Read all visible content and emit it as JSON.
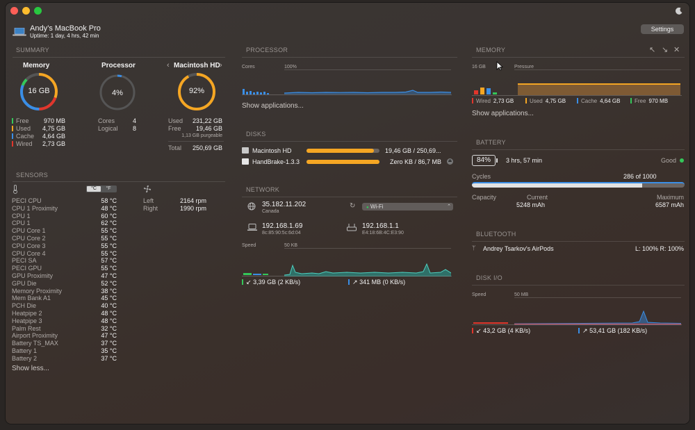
{
  "header": {
    "device_name": "Andy’s MacBook Pro",
    "uptime": "Uptime: 1 day, 4 hrs, 42 min",
    "settings_label": "Settings"
  },
  "summary": {
    "title": "SUMMARY",
    "memory": {
      "label": "Memory",
      "center": "16 GB",
      "rows": [
        {
          "name": "Free",
          "value": "970 MB",
          "color": "#34c759"
        },
        {
          "name": "Used",
          "value": "4,75 GB",
          "color": "#f5a623"
        },
        {
          "name": "Cache",
          "value": "4,64 GB",
          "color": "#3a8ee6"
        },
        {
          "name": "Wired",
          "value": "2,73 GB",
          "color": "#e0362c"
        }
      ]
    },
    "processor": {
      "label": "Processor",
      "center": "4%",
      "rows": [
        {
          "name": "Cores",
          "value": "4"
        },
        {
          "name": "Logical",
          "value": "8"
        }
      ]
    },
    "disk": {
      "label": "Macintosh HD",
      "center": "92%",
      "used_label": "Used",
      "used": "231,22 GB",
      "free_label": "Free",
      "free": "19,46 GB",
      "purgeable": "1,13 GB purgeable",
      "total_label": "Total",
      "total": "250,69 GB"
    }
  },
  "sensors": {
    "title": "SENSORS",
    "unit_c": "°C",
    "unit_f": "°F",
    "items": [
      {
        "name": "PECI CPU",
        "value": "58 °C"
      },
      {
        "name": "CPU 1 Proximity",
        "value": "48 °C"
      },
      {
        "name": "CPU 1",
        "value": "60 °C"
      },
      {
        "name": "CPU 1",
        "value": "62 °C"
      },
      {
        "name": "CPU Core 1",
        "value": "55 °C"
      },
      {
        "name": "CPU Core 2",
        "value": "55 °C"
      },
      {
        "name": "CPU Core 3",
        "value": "55 °C"
      },
      {
        "name": "CPU Core 4",
        "value": "55 °C"
      },
      {
        "name": "PECI SA",
        "value": "57 °C"
      },
      {
        "name": "PECI GPU",
        "value": "55 °C"
      },
      {
        "name": "GPU Proximity",
        "value": "47 °C"
      },
      {
        "name": "GPU Die",
        "value": "52 °C"
      },
      {
        "name": "Memory Proximity",
        "value": "38 °C"
      },
      {
        "name": "Mem Bank A1",
        "value": "45 °C"
      },
      {
        "name": "PCH Die",
        "value": "40 °C"
      },
      {
        "name": "Heatpipe 2",
        "value": "48 °C"
      },
      {
        "name": "Heatpipe 3",
        "value": "48 °C"
      },
      {
        "name": "Palm Rest",
        "value": "32 °C"
      },
      {
        "name": "Airport Proximity",
        "value": "47 °C"
      },
      {
        "name": "Battery TS_MAX",
        "value": "37 °C"
      },
      {
        "name": "Battery 1",
        "value": "35 °C"
      },
      {
        "name": "Battery 2",
        "value": "37 °C"
      }
    ],
    "fans": [
      {
        "name": "Left",
        "value": "2164 rpm"
      },
      {
        "name": "Right",
        "value": "1990 rpm"
      }
    ],
    "show_less": "Show less..."
  },
  "processor": {
    "title": "PROCESSOR",
    "cores_label": "Cores",
    "pct_label": "100%",
    "show_apps": "Show applications..."
  },
  "disks": {
    "title": "DISKS",
    "items": [
      {
        "name": "Macintosh HD",
        "value": "19,46 GB / 250,69...",
        "used_fraction": 0.92
      },
      {
        "name": "HandBrake-1.3.3",
        "value": "Zero KB / 86,7 MB",
        "used_fraction": 1.0
      }
    ]
  },
  "network": {
    "title": "NETWORK",
    "public_ip": "35.182.11.202",
    "country": "Canada",
    "wifi_label": "Wi-Fi",
    "local_ip": "192.168.1.69",
    "local_mac": "8c:85:90:5c:6d:04",
    "router_ip": "192.168.1.1",
    "router_mac": "E4:18:6B:4C:E3:90",
    "speed_label": "Speed",
    "scale_label": "50 KB",
    "download": "3,39 GB (2 KB/s)",
    "upload": "341 MB (0 KB/s)"
  },
  "memory": {
    "title": "MEMORY",
    "total_label": "16 GB",
    "pressure_label": "Pressure",
    "legend": [
      {
        "name": "Wired",
        "value": "2,73 GB",
        "color": "#e0362c"
      },
      {
        "name": "Used",
        "value": "4,75 GB",
        "color": "#f5a623"
      },
      {
        "name": "Cache",
        "value": "4,64 GB",
        "color": "#3a8ee6"
      },
      {
        "name": "Free",
        "value": "970 MB",
        "color": "#34c759"
      }
    ],
    "show_apps": "Show applications..."
  },
  "battery": {
    "title": "BATTERY",
    "percent": "84%",
    "percent_fraction": 0.84,
    "time": "3 hrs, 57 min",
    "health": "Good",
    "cycles_label": "Cycles",
    "cycles_value": "286 of 1000",
    "cycles_fraction": 0.286,
    "capacity_label": "Capacity",
    "current_label": "Current",
    "current_value": "5248 mAh",
    "max_label": "Maximum",
    "max_value": "6587 mAh",
    "capacity_fraction": 0.8
  },
  "bluetooth": {
    "title": "BLUETOOTH",
    "device": "Andrey Tsarkov's AirPods",
    "levels": "L: 100% R: 100%"
  },
  "disk_io": {
    "title": "DISK I/O",
    "speed_label": "Speed",
    "scale_label": "50 MB",
    "read": "43,2 GB (4 KB/s)",
    "write": "53,41 GB (182 KB/s)"
  },
  "colors": {
    "accent_orange": "#f5a623",
    "blue": "#3a8ee6",
    "green": "#34c759",
    "red": "#e0362c",
    "teal": "#26a69a"
  }
}
